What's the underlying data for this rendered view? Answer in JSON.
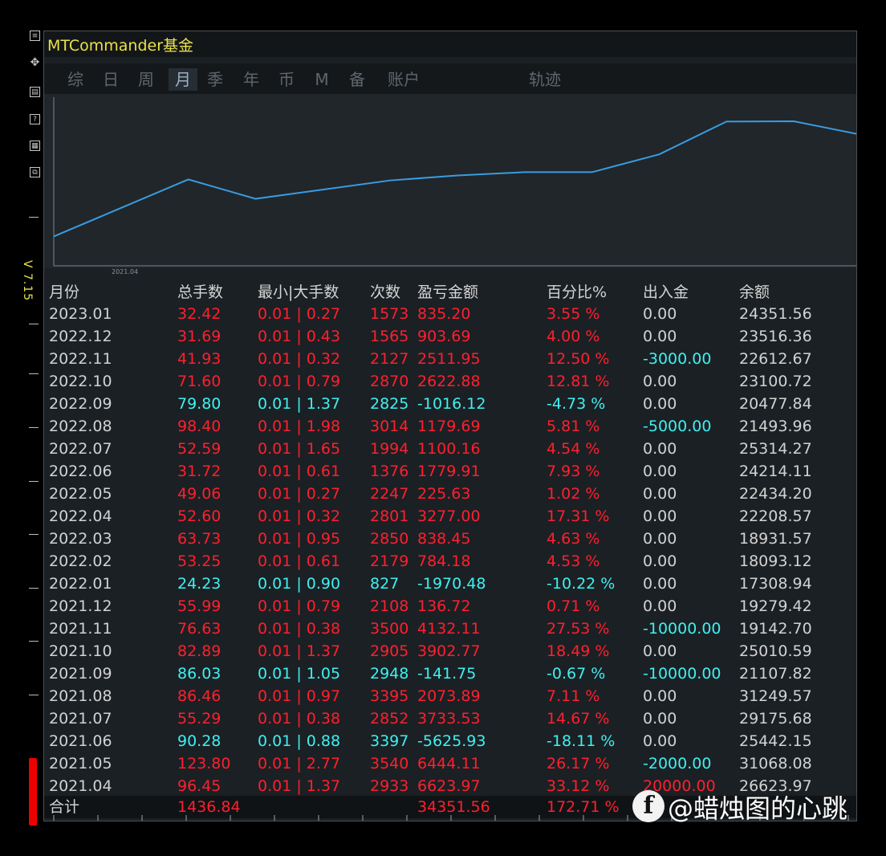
{
  "app": {
    "title": "MTCommander基金",
    "version": "V 7.15"
  },
  "tabs": [
    {
      "label": "综",
      "active": false
    },
    {
      "label": "日",
      "active": false
    },
    {
      "label": "周",
      "active": false
    },
    {
      "label": "月",
      "active": true
    },
    {
      "label": "季",
      "active": false
    },
    {
      "label": "年",
      "active": false
    },
    {
      "label": "币",
      "active": false
    },
    {
      "label": "M",
      "active": false
    },
    {
      "label": "备",
      "active": false
    },
    {
      "label": "账户",
      "active": false
    },
    {
      "label": "轨迹",
      "active": false
    }
  ],
  "toolbar_icons": [
    "menu-icon",
    "move-icon",
    "list-icon",
    "help-icon",
    "grid-icon",
    "window-icon"
  ],
  "chart_data": {
    "type": "line",
    "x_tick_label": "2021.04",
    "line_color": "#3a9be0",
    "x": [
      "2021.04",
      "2021.05",
      "2021.06",
      "2021.07",
      "2021.08",
      "2021.09",
      "2021.10",
      "2021.11",
      "2021.12",
      "2022.01",
      "2022.02",
      "2022.03",
      "2022.04"
    ],
    "y": [
      6624,
      13068,
      19510,
      15135,
      17209,
      19282,
      20414,
      21146,
      21146,
      25180,
      32590,
      32640,
      29600
    ]
  },
  "table": {
    "headers": [
      "月份",
      "总手数",
      "最小|大手数",
      "次数",
      "盈亏金额",
      "百分比%",
      "出入金",
      "余额"
    ],
    "rows": [
      [
        "2023.01",
        "32.42",
        "0.01 | 0.27",
        "1573",
        "835.20",
        "3.55 %",
        "0.00",
        "24351.56"
      ],
      [
        "2022.12",
        "31.69",
        "0.01 | 0.43",
        "1565",
        "903.69",
        "4.00 %",
        "0.00",
        "23516.36"
      ],
      [
        "2022.11",
        "41.93",
        "0.01 | 0.32",
        "2127",
        "2511.95",
        "12.50 %",
        "-3000.00",
        "22612.67"
      ],
      [
        "2022.10",
        "71.60",
        "0.01 | 0.79",
        "2870",
        "2622.88",
        "12.81 %",
        "0.00",
        "23100.72"
      ],
      [
        "2022.09",
        "79.80",
        "0.01 | 1.37",
        "2825",
        "-1016.12",
        "-4.73 %",
        "0.00",
        "20477.84"
      ],
      [
        "2022.08",
        "98.40",
        "0.01 | 1.98",
        "3014",
        "1179.69",
        "5.81 %",
        "-5000.00",
        "21493.96"
      ],
      [
        "2022.07",
        "52.59",
        "0.01 | 1.65",
        "1994",
        "1100.16",
        "4.54 %",
        "0.00",
        "25314.27"
      ],
      [
        "2022.06",
        "31.72",
        "0.01 | 0.61",
        "1376",
        "1779.91",
        "7.93 %",
        "0.00",
        "24214.11"
      ],
      [
        "2022.05",
        "49.06",
        "0.01 | 0.27",
        "2247",
        "225.63",
        "1.02 %",
        "0.00",
        "22434.20"
      ],
      [
        "2022.04",
        "52.60",
        "0.01 | 0.32",
        "2801",
        "3277.00",
        "17.31 %",
        "0.00",
        "22208.57"
      ],
      [
        "2022.03",
        "63.73",
        "0.01 | 0.95",
        "2850",
        "838.45",
        "4.63 %",
        "0.00",
        "18931.57"
      ],
      [
        "2022.02",
        "53.25",
        "0.01 | 0.61",
        "2179",
        "784.18",
        "4.53 %",
        "0.00",
        "18093.12"
      ],
      [
        "2022.01",
        "24.23",
        "0.01 | 0.90",
        "827",
        "-1970.48",
        "-10.22 %",
        "0.00",
        "17308.94"
      ],
      [
        "2021.12",
        "55.99",
        "0.01 | 0.79",
        "2108",
        "136.72",
        "0.71 %",
        "0.00",
        "19279.42"
      ],
      [
        "2021.11",
        "76.63",
        "0.01 | 0.38",
        "3500",
        "4132.11",
        "27.53 %",
        "-10000.00",
        "19142.70"
      ],
      [
        "2021.10",
        "82.89",
        "0.01 | 1.37",
        "2905",
        "3902.77",
        "18.49 %",
        "0.00",
        "25010.59"
      ],
      [
        "2021.09",
        "86.03",
        "0.01 | 1.05",
        "2948",
        "-141.75",
        "-0.67 %",
        "-10000.00",
        "21107.82"
      ],
      [
        "2021.08",
        "86.46",
        "0.01 | 0.97",
        "3395",
        "2073.89",
        "7.11 %",
        "0.00",
        "31249.57"
      ],
      [
        "2021.07",
        "55.29",
        "0.01 | 0.38",
        "2852",
        "3733.53",
        "14.67 %",
        "0.00",
        "29175.68"
      ],
      [
        "2021.06",
        "90.28",
        "0.01 | 0.88",
        "3397",
        "-5625.93",
        "-18.11 %",
        "0.00",
        "25442.15"
      ],
      [
        "2021.05",
        "123.80",
        "0.01 | 2.77",
        "3540",
        "6444.11",
        "26.17 %",
        "-2000.00",
        "31068.08"
      ],
      [
        "2021.04",
        "96.45",
        "0.01 | 1.37",
        "2933",
        "6623.97",
        "33.12 %",
        "20000.00",
        "26623.97"
      ]
    ],
    "total": {
      "label": "合计",
      "lots": "1436.84",
      "pnl": "34351.56",
      "percent": "172.71 %"
    }
  },
  "colors": {
    "positive": "#ff1f2e",
    "negative": "#3ff0f0",
    "neutral": "#d2d2d2",
    "title": "#e8e24a"
  },
  "watermark": {
    "logo": "f",
    "text": "@蜡烛图的心跳"
  }
}
